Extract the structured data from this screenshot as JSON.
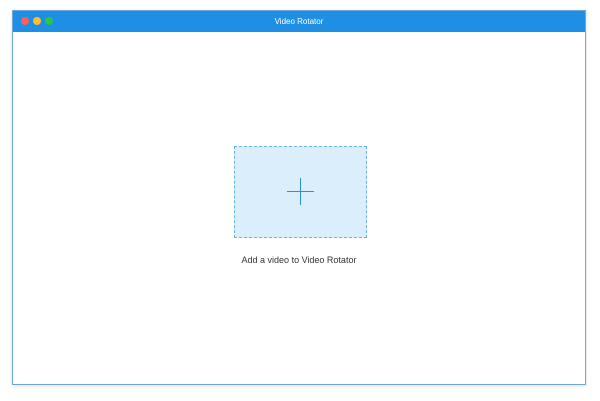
{
  "window": {
    "title": "Video Rotator",
    "traffic_lights": {
      "close_color": "#ff5f57",
      "minimize_color": "#febc2e",
      "maximize_color": "#28c840"
    },
    "titlebar_color": "#1f8fe6"
  },
  "main": {
    "dropzone_icon": "plus-icon",
    "dropzone_background": "#daeefc",
    "caption": "Add a video to Video Rotator"
  }
}
